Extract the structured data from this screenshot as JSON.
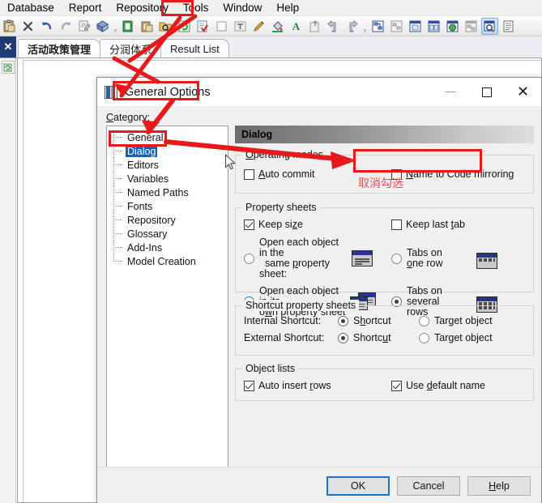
{
  "menubar": {
    "items": [
      {
        "label": "Database"
      },
      {
        "label": "Report"
      },
      {
        "label": "Repository"
      },
      {
        "label": "Tools",
        "highlighted": true
      },
      {
        "label": "Window"
      },
      {
        "label": "Help"
      }
    ]
  },
  "toolbar": {
    "group1": [
      "paste-icon",
      "delete-x-icon",
      "undo-icon",
      "redo-icon",
      "properties-icon",
      "package-icon"
    ],
    "group2": [
      "new-model-icon",
      "open-model-icon",
      "find-objects-icon",
      "refresh-icon",
      "check-model-icon",
      "blank-page-icon",
      "text-frame-icon",
      "pencil-icon",
      "fill-color-icon",
      "font-color-icon",
      "export-icon",
      "previous-icon",
      "next-icon"
    ],
    "group3": [
      "diagram-icon",
      "sub-diagram-icon",
      "page-icon",
      "two-page-icon",
      "globe-diagram-icon",
      "network-diagram-icon",
      "browse-diagram-icon",
      "list-icon"
    ],
    "selected_icon": "browse-diagram-icon"
  },
  "tabstrip": {
    "close_label": "✕",
    "tabs": [
      {
        "label": "活动政策管理",
        "active": true,
        "cjk": true
      },
      {
        "label": "分润体系",
        "active": false,
        "cjk": true
      },
      {
        "label": "Result List",
        "active": false,
        "cjk": false
      }
    ]
  },
  "dialog": {
    "title": "General Options",
    "window_controls": {
      "minimize": "—",
      "maximize": "□",
      "close": "✕"
    },
    "category_label": "Category:",
    "tree": [
      {
        "label": "General",
        "selected": false
      },
      {
        "label": "Dialog",
        "selected": true
      },
      {
        "label": "Editors",
        "selected": false
      },
      {
        "label": "Variables",
        "selected": false
      },
      {
        "label": "Named Paths",
        "selected": false
      },
      {
        "label": "Fonts",
        "selected": false
      },
      {
        "label": "Repository",
        "selected": false
      },
      {
        "label": "Glossary",
        "selected": false
      },
      {
        "label": "Add-Ins",
        "selected": false
      },
      {
        "label": "Model Creation",
        "selected": false
      }
    ],
    "pane_header": "Dialog",
    "groups": {
      "operating_modes": {
        "legend": "Operating modes",
        "auto_commit": {
          "label": "Auto commit",
          "checked": false
        },
        "name_to_code": {
          "label": "Name to Code mirroring",
          "checked": false
        }
      },
      "property_sheets": {
        "legend": "Property sheets",
        "keep_size": {
          "label": "Keep size",
          "checked": true
        },
        "keep_last_tab": {
          "label": "Keep last tab",
          "checked": false
        },
        "open_same": {
          "label_line1": "Open each object in the",
          "label_line2": "same property sheet:",
          "selected": false
        },
        "open_own": {
          "label_line1": "Open each object in its",
          "label_line2": "own property sheet",
          "selected": true
        },
        "tabs_one_row": {
          "label_line1": "Tabs on",
          "label_line2": "one row",
          "selected": false
        },
        "tabs_several_rows": {
          "label_line1": "Tabs on",
          "label_line2": "several rows",
          "selected": true
        }
      },
      "shortcut_property_sheets": {
        "legend": "Shortcut property sheets",
        "internal_label": "Internal Shortcut:",
        "external_label": "External Shortcut:",
        "internal_shortcut": {
          "label": "Shortcut",
          "selected": true
        },
        "internal_target": {
          "label": "Target object",
          "selected": false
        },
        "external_shortcut": {
          "label": "Shortcut",
          "selected": true
        },
        "external_target": {
          "label": "Target object",
          "selected": false
        }
      },
      "object_lists": {
        "legend": "Object lists",
        "auto_insert_rows": {
          "label": "Auto insert rows",
          "checked": true
        },
        "use_default_name": {
          "label": "Use default name",
          "checked": true
        }
      }
    },
    "buttons": {
      "ok": "OK",
      "cancel": "Cancel",
      "help": "Help"
    }
  },
  "annotations": {
    "highlight_color": "#e8191b",
    "chinese_note": "取消勾选",
    "boxes": [
      "tools-menu-highlight",
      "general-options-title-highlight",
      "dialog-tree-item-highlight",
      "name-to-code-mirroring-highlight"
    ]
  }
}
